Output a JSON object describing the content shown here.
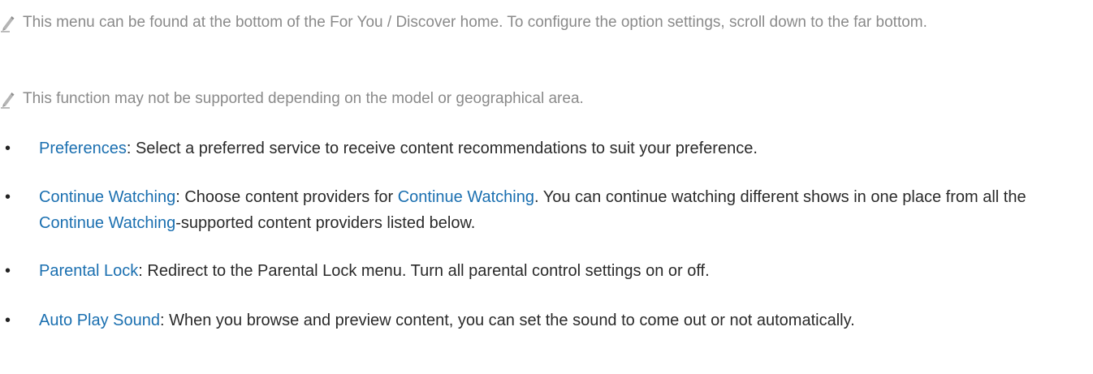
{
  "notes": [
    {
      "icon": "pencil-icon",
      "text": "This menu can be found at the bottom of the For You / Discover home. To configure the option settings, scroll down to the far bottom."
    },
    {
      "icon": "pencil-icon",
      "text": "This function may not be supported depending on the model or geographical area."
    }
  ],
  "bullets": [
    {
      "term": "Preferences",
      "text": ": Select a preferred service to receive content recommendations to suit your preference."
    },
    {
      "term": "Continue Watching",
      "text_a": ": Choose content providers for ",
      "term_b": "Continue Watching",
      "text_b": ". You can continue watching different shows in one place from all the ",
      "term_c": "Continue Watching",
      "text_c": "-supported content providers listed below."
    },
    {
      "term": "Parental Lock",
      "text": ": Redirect to the Parental Lock menu. Turn all parental control settings on or off."
    },
    {
      "term": "Auto Play Sound",
      "text": ": When you browse and preview content, you can set the sound to come out or not automatically."
    }
  ],
  "colors": {
    "term": "#1a6fb0",
    "body": "#2a2a2a",
    "note": "#8a8a8a"
  }
}
